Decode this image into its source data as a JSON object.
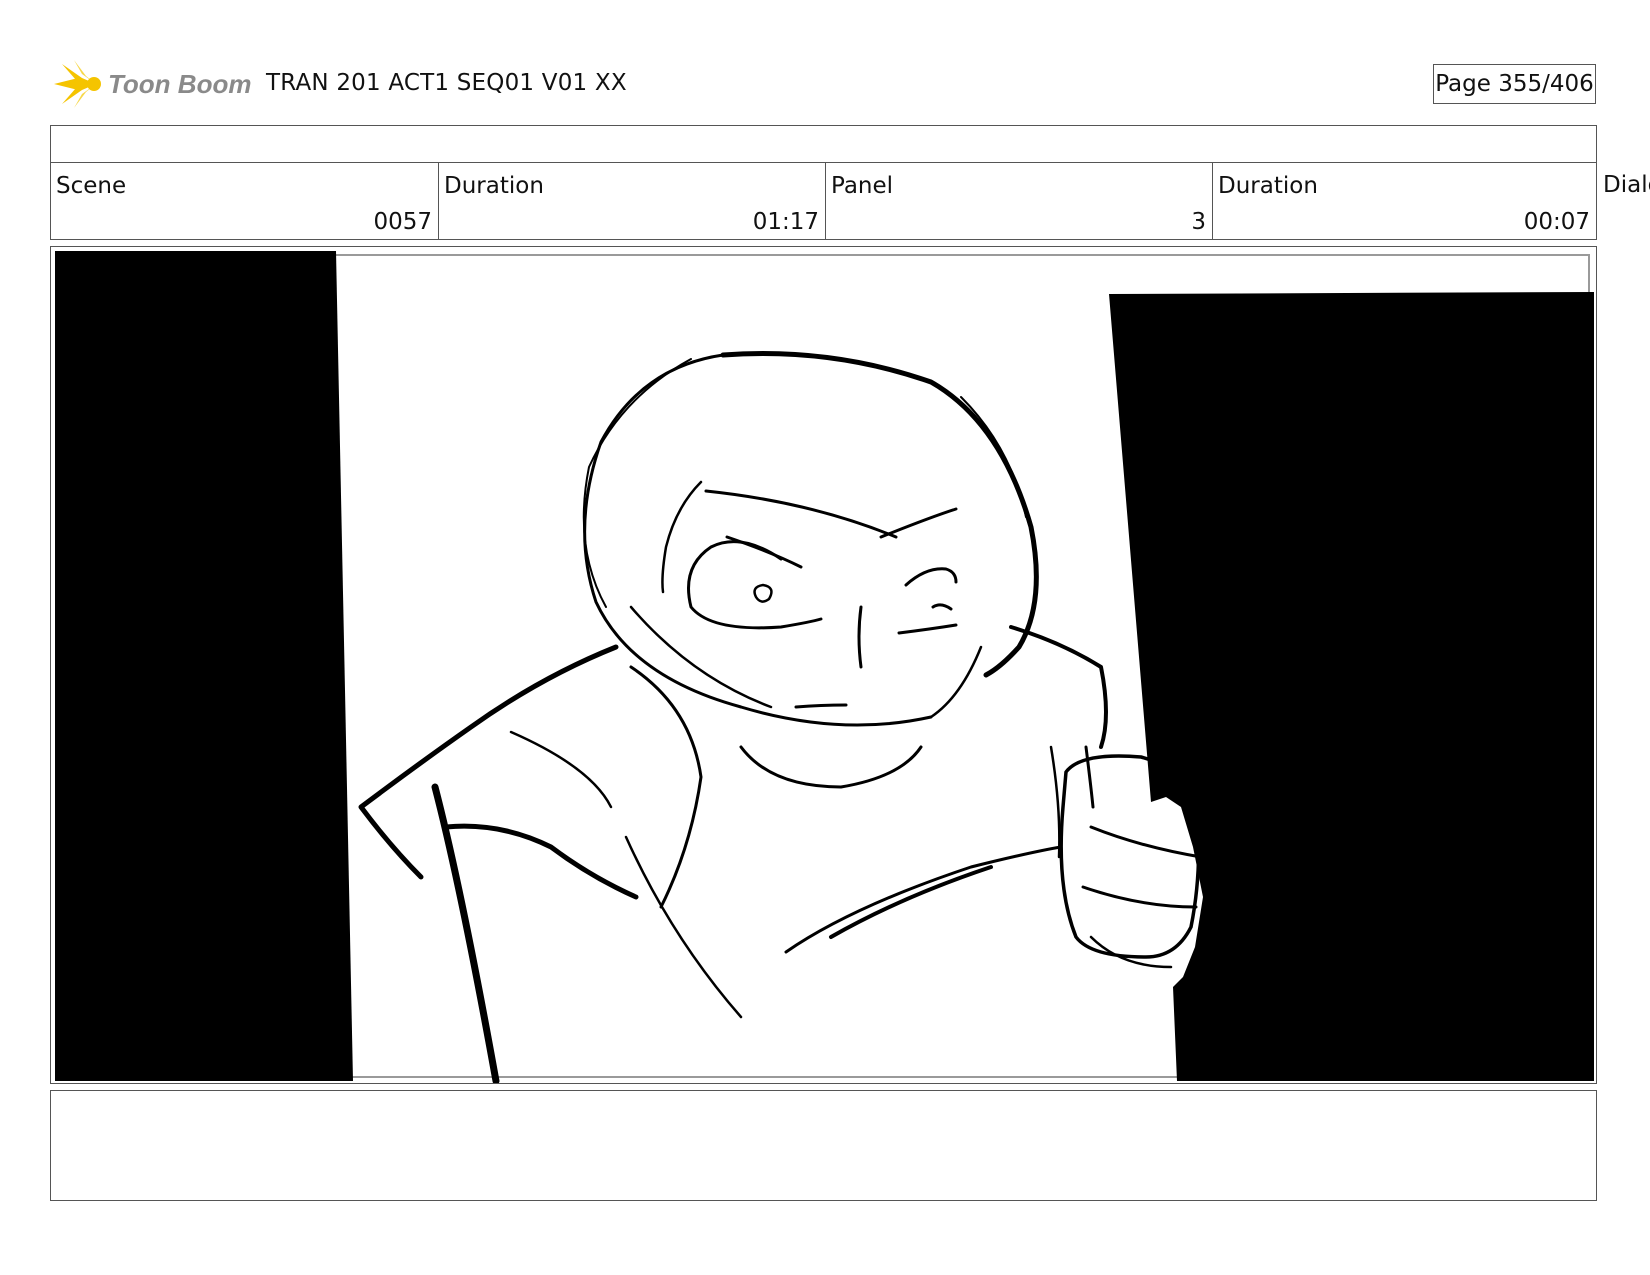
{
  "header": {
    "logo_text": "Toon Boom",
    "document_title": "TRAN 201 ACT1 SEQ01 V01 XX",
    "page_indicator": "Page 355/406"
  },
  "info": {
    "scene_label": "Scene",
    "scene_value": "0057",
    "scene_duration_label": "Duration",
    "scene_duration_value": "01:17",
    "panel_label": "Panel",
    "panel_value": "3",
    "panel_duration_label": "Duration",
    "panel_duration_value": "00:07",
    "overflow_label": "Dialo"
  },
  "colors": {
    "logo_yellow": "#f5c400",
    "logo_text": "#8a8a8a",
    "ink": "#000000",
    "border": "#555555"
  }
}
